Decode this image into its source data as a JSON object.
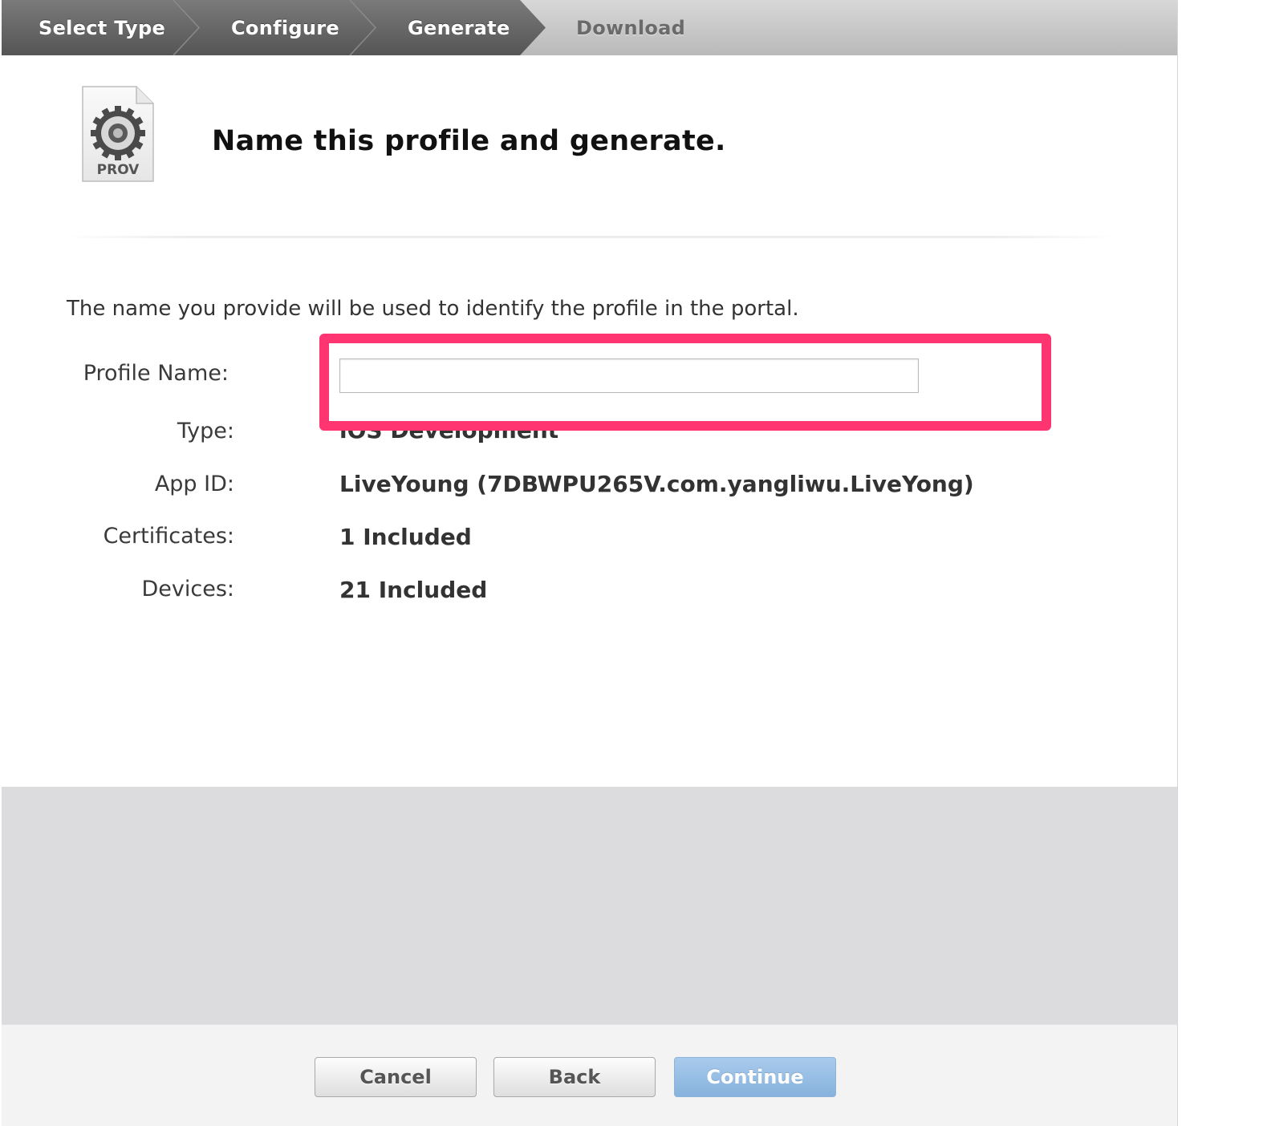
{
  "steps": {
    "items": [
      {
        "label": "Select Type",
        "state": "done"
      },
      {
        "label": "Configure",
        "state": "done"
      },
      {
        "label": "Generate",
        "state": "current"
      },
      {
        "label": "Download",
        "state": "pending"
      }
    ]
  },
  "header": {
    "icon_label": "PROV",
    "icon": "provisioning-profile-gear-icon",
    "title": "Name this profile and generate."
  },
  "form": {
    "description": "The name you provide will be used to identify the profile in the portal.",
    "profile_name_label": "Profile Name:",
    "profile_name_value": "",
    "fields": [
      {
        "label": "Type:",
        "value": "iOS Development"
      },
      {
        "label": "App ID:",
        "value": "LiveYoung (7DBWPU265V.com.yangliwu.LiveYong)"
      },
      {
        "label": "Certificates:",
        "value": "1 Included"
      },
      {
        "label": "Devices:",
        "value": "21 Included"
      }
    ]
  },
  "buttons": {
    "cancel": "Cancel",
    "back": "Back",
    "continue": "Continue"
  },
  "colors": {
    "highlight": "#ff3572",
    "continue_button": "#98bfe6",
    "steps_done": "#666666"
  }
}
